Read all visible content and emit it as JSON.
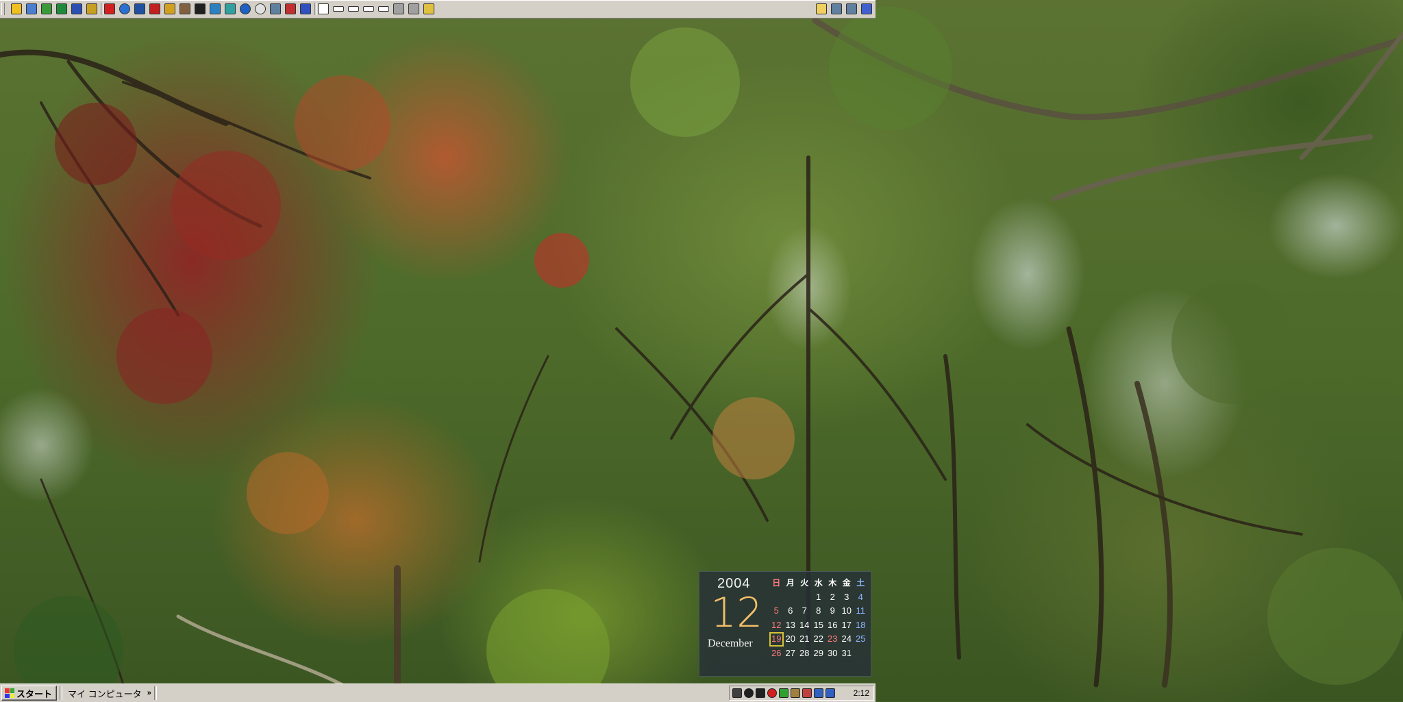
{
  "top_toolbar": {
    "group1_icons": [
      {
        "icon": "app-icon",
        "color": "#f0c020"
      },
      {
        "icon": "folder-window-icon",
        "color": "#4a7fd0"
      },
      {
        "icon": "paint-icon",
        "color": "#3a9a3a"
      },
      {
        "icon": "spreadsheet-icon",
        "color": "#1f8a3a"
      },
      {
        "icon": "word-icon",
        "color": "#2a4fb0"
      },
      {
        "icon": "settings-icon",
        "color": "#c8a020"
      }
    ],
    "group2_icons": [
      {
        "icon": "acrobat-icon",
        "color": "#d02020"
      },
      {
        "icon": "browser-icon",
        "color": "#2a70d0"
      },
      {
        "icon": "z-icon",
        "color": "#2050a0"
      },
      {
        "icon": "red-app-icon",
        "color": "#c02020"
      },
      {
        "icon": "palette-icon",
        "color": "#d0a020"
      },
      {
        "icon": "clipboard-icon",
        "color": "#806040"
      },
      {
        "icon": "terminal-icon",
        "color": "#202020"
      },
      {
        "icon": "screen-icon",
        "color": "#2a80c0"
      },
      {
        "icon": "chat-icon",
        "color": "#30a0a0"
      },
      {
        "icon": "globe-icon",
        "color": "#2060c0"
      },
      {
        "icon": "cd-icon",
        "color": "#e0e0e0"
      },
      {
        "icon": "tools-icon",
        "color": "#6080a0"
      },
      {
        "icon": "mail-icon",
        "color": "#c03030"
      },
      {
        "icon": "pen-icon",
        "color": "#3050c0"
      }
    ],
    "group3_icons": [
      {
        "icon": "window-icon",
        "color": "#ffffff"
      },
      {
        "icon": "minimized-window-icon",
        "color": "#ffffff"
      },
      {
        "icon": "minimized-window-icon",
        "color": "#ffffff"
      },
      {
        "icon": "minimized-window-icon",
        "color": "#ffffff"
      },
      {
        "icon": "minimized-window-icon",
        "color": "#ffffff"
      },
      {
        "icon": "magnifier-icon",
        "color": "#a0a0a0"
      },
      {
        "icon": "search-icon",
        "color": "#a0a0a0"
      },
      {
        "icon": "photo-icon",
        "color": "#e0c040"
      }
    ],
    "group4_icons": [
      {
        "icon": "folder-icon",
        "color": "#f0d060"
      },
      {
        "icon": "my-computer-icon",
        "color": "#6080a0"
      },
      {
        "icon": "network-icon",
        "color": "#6080a0"
      },
      {
        "icon": "help-icon",
        "color": "#4060d0"
      }
    ]
  },
  "calendar": {
    "year": "2004",
    "month_number": "12",
    "month_name": "December",
    "weekday_headers": [
      "日",
      "月",
      "火",
      "水",
      "木",
      "金",
      "土"
    ],
    "weeks": [
      [
        "",
        "",
        "",
        "1",
        "2",
        "3",
        "4"
      ],
      [
        "5",
        "6",
        "7",
        "8",
        "9",
        "10",
        "11"
      ],
      [
        "12",
        "13",
        "14",
        "15",
        "16",
        "17",
        "18"
      ],
      [
        "19",
        "20",
        "21",
        "22",
        "23",
        "24",
        "25"
      ],
      [
        "26",
        "27",
        "28",
        "29",
        "30",
        "31",
        ""
      ]
    ],
    "today": "19",
    "holidays": [
      "23"
    ],
    "colors": {
      "sunday": "#ff7a7a",
      "saturday": "#8fb8ff",
      "today_border": "#d6c23a",
      "month_number": "#f4c068"
    }
  },
  "taskbar": {
    "start_label": "スタート",
    "quicklaunch_label": "マイ コンピュータ",
    "quicklaunch_chevron": "»",
    "tray_icons": [
      {
        "icon": "volume-icon",
        "color": "#404040"
      },
      {
        "icon": "disc-icon",
        "color": "#202020"
      },
      {
        "icon": "arrow-down-icon",
        "color": "#202020"
      },
      {
        "icon": "antivirus-icon",
        "color": "#d02020"
      },
      {
        "icon": "network-tray-icon",
        "color": "#30a030"
      },
      {
        "icon": "wrench-icon",
        "color": "#a08040"
      },
      {
        "icon": "tablet-icon",
        "color": "#c04040"
      },
      {
        "icon": "ime-icon",
        "color": "#3060c0"
      },
      {
        "icon": "user-icon",
        "color": "#3060c0"
      }
    ],
    "clock": "2:12"
  }
}
